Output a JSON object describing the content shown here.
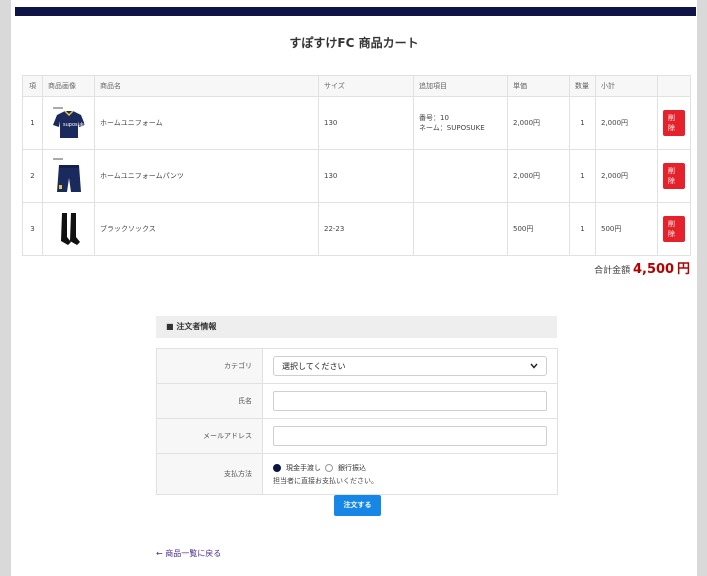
{
  "title": "すぽすけFC 商品カート",
  "table": {
    "headers": [
      "項",
      "商品画像",
      "商品名",
      "サイズ",
      "追加項目",
      "単価",
      "数量",
      "小計",
      ""
    ],
    "rows": [
      {
        "index": "1",
        "name": "ホームユニフォーム",
        "size": "130",
        "extra_line1": "番号：10",
        "extra_line2": "ネーム：SUPOSUKE",
        "price": "2,000円",
        "qty": "1",
        "subtotal": "2,000円",
        "delete": "削除"
      },
      {
        "index": "2",
        "name": "ホームユニフォームパンツ",
        "size": "130",
        "extra_line1": "",
        "extra_line2": "",
        "price": "2,000円",
        "qty": "1",
        "subtotal": "2,000円",
        "delete": "削除"
      },
      {
        "index": "3",
        "name": "ブラックソックス",
        "size": "22-23",
        "extra_line1": "",
        "extra_line2": "",
        "price": "500円",
        "qty": "1",
        "subtotal": "500円",
        "delete": "削除"
      }
    ]
  },
  "total": {
    "label": "合計金額",
    "amount": "4,500",
    "unit": "円"
  },
  "order_info": {
    "heading": "■ 注文者情報",
    "category_label": "カテゴリ",
    "category_value": "選択してください",
    "name_label": "氏名",
    "email_label": "メールアドレス",
    "payment_label": "支払方法",
    "payment_options": [
      "現金手渡し",
      "銀行振込"
    ],
    "payment_selected": "現金手渡し",
    "payment_note": "担当者に直接お支払いください。"
  },
  "submit_label": "注文する",
  "back_link": "← 商品一覧に戻る",
  "colors": {
    "topbar": "#0d1446",
    "delete": "#e5212b",
    "submit": "#1687e6",
    "total": "#b50000"
  }
}
